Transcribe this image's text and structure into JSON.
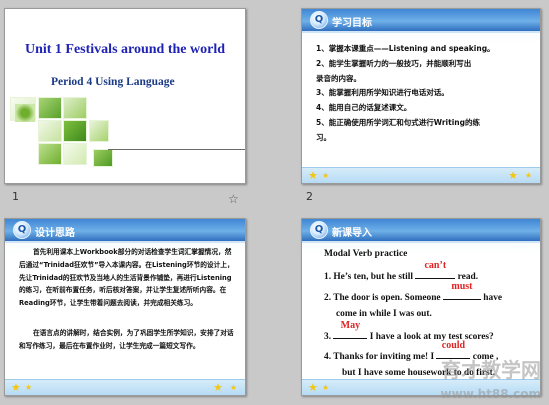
{
  "slide1": {
    "title": "Unit 1 Festivals around the world",
    "subtitle": "Period 4  Using Language",
    "number": "1"
  },
  "slide2": {
    "header": "学习目标",
    "badge": "Q",
    "number": "2",
    "items": [
      "1、掌握本课重点——Listening and speaking。",
      "2、能学生掌握听力的一般技巧，并能顺利写出",
      "录音的内容。",
      "3、能掌握利用所学知识进行电话对话。",
      "4、能用自己的话复述课文。",
      "5、能正确使用所学词汇和句式进行Writing的练",
      "习。"
    ]
  },
  "slide3": {
    "header": "设计思路",
    "badge": "Q",
    "paragraphs": [
      "首先利用课本上Workbook部分的对话检查学生词汇掌握情况，然后通过“Trinidad狂欢节”导入本课内容。在Listening环节的设计上，先让Trinidad的狂欢节及当地人的生活背景作铺垫，再进行Listening的练习，在听前布置任务，听后核对答案，并让学生复述所听内容。在Reading环节，让学生带着问题去阅读，并完成相关练习。",
      "在语言点的讲解时，结合实例，为了巩固学生所学知识，安排了对话和写作练习，最后在布置作业时，让学生完成一篇短文写作。"
    ]
  },
  "slide4": {
    "header": "新课导入",
    "badge": "Q",
    "heading": "Modal Verb practice",
    "questions": [
      {
        "pre": "1. He’s ten, but he still",
        "answer": "can’t",
        "post": "read."
      },
      {
        "pre": "2. The door is open. Someone",
        "answer": "must",
        "post": "have"
      },
      {
        "pre": "come in while I was out.",
        "answer": "",
        "post": ""
      },
      {
        "pre": "3.",
        "answer": "May",
        "post": "I have a look at my test scores?"
      },
      {
        "pre": "4. Thanks for inviting me! I",
        "answer": "could",
        "post": "come ,"
      },
      {
        "pre": "but I have some housework to do first.",
        "answer": "",
        "post": ""
      }
    ]
  },
  "watermark": {
    "brand": "育才教学网",
    "url": "www.ht88.com"
  }
}
